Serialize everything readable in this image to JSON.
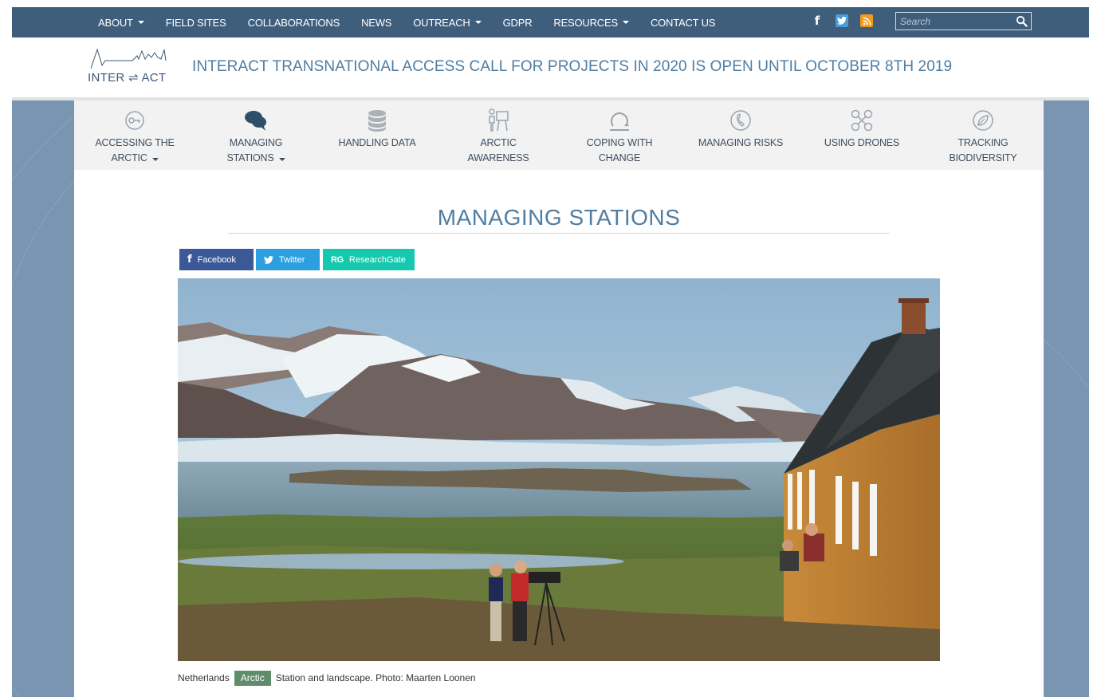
{
  "topnav": {
    "items": [
      {
        "label": "ABOUT",
        "dropdown": true
      },
      {
        "label": "FIELD SITES",
        "dropdown": false
      },
      {
        "label": "COLLABORATIONS",
        "dropdown": false
      },
      {
        "label": "NEWS",
        "dropdown": false
      },
      {
        "label": "OUTREACH",
        "dropdown": true
      },
      {
        "label": "GDPR",
        "dropdown": false
      },
      {
        "label": "RESOURCES",
        "dropdown": true
      },
      {
        "label": "CONTACT US",
        "dropdown": false
      }
    ],
    "social_icons": [
      "facebook-icon",
      "twitter-icon",
      "rss-icon"
    ],
    "search": {
      "placeholder": "Search",
      "value": ""
    }
  },
  "header": {
    "logo_text": "INTER ⇌ ACT",
    "announcement": "INTERACT TRANSNATIONAL ACCESS CALL FOR PROJECTS IN 2020 IS OPEN UNTIL OCTOBER 8TH 2019"
  },
  "catnav": {
    "items": [
      {
        "line1": "ACCESSING THE",
        "line2": "ARCTIC",
        "dropdown": true,
        "icon": "key-icon"
      },
      {
        "line1": "MANAGING",
        "line2": "STATIONS",
        "dropdown": true,
        "icon": "chat-bubbles-icon",
        "active": true
      },
      {
        "line1": "HANDLING DATA",
        "line2": "",
        "dropdown": false,
        "icon": "database-icon"
      },
      {
        "line1": "ARCTIC",
        "line2": "AWARENESS",
        "dropdown": false,
        "icon": "presenter-icon"
      },
      {
        "line1": "COPING WITH",
        "line2": "CHANGE",
        "dropdown": false,
        "icon": "cycle-icon"
      },
      {
        "line1": "MANAGING RISKS",
        "line2": "",
        "dropdown": false,
        "icon": "phone-icon"
      },
      {
        "line1": "USING DRONES",
        "line2": "",
        "dropdown": false,
        "icon": "drone-icon"
      },
      {
        "line1": "TRACKING",
        "line2": "BIODIVERSITY",
        "dropdown": false,
        "icon": "leaf-icon"
      }
    ]
  },
  "main": {
    "title": "MANAGING STATIONS",
    "share": {
      "facebook": "Facebook",
      "twitter": "Twitter",
      "researchgate_mark": "RG",
      "researchgate": "ResearchGate"
    },
    "caption": {
      "before": "Netherlands",
      "tag": "Arctic",
      "after": "Station and landscape. Photo: Maarten Loonen"
    }
  },
  "colors": {
    "topbar": "#3e5e7b",
    "side": "#7995b1",
    "accent_text": "#4f7da3",
    "facebook": "#3b5998",
    "twitter": "#2b9fe0",
    "researchgate": "#16c8ae",
    "tag": "#5f8d6c"
  }
}
